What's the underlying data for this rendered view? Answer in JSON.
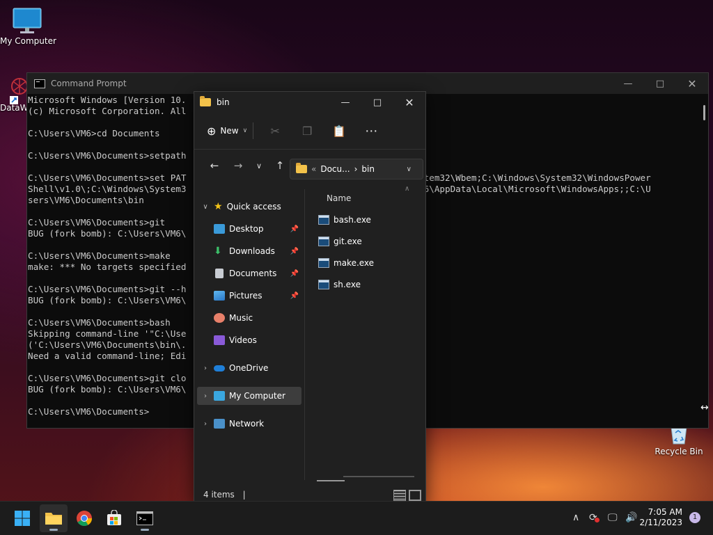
{
  "desktop": {
    "icons": [
      {
        "label": "My Computer"
      },
      {
        "label": "DataW"
      },
      {
        "label": "Recycle Bin"
      }
    ]
  },
  "cmd": {
    "title": "Command Prompt",
    "lines": [
      "Microsoft Windows [Version 10.",
      "(c) Microsoft Corporation. All",
      "",
      "C:\\Users\\VM6>cd Documents",
      "",
      "C:\\Users\\VM6\\Documents>setpath",
      "",
      "C:\\Users\\VM6\\Documents>set PAT                                       ws\\System32\\Wbem;C:\\Windows\\System32\\WindowsPower",
      "Shell\\v1.0\\;C:\\Windows\\System3                                       ers\\VM6\\AppData\\Local\\Microsoft\\WindowsApps;;C:\\U",
      "sers\\VM6\\Documents\\bin",
      "",
      "C:\\Users\\VM6\\Documents>git",
      "BUG (fork bomb): C:\\Users\\VM6\\",
      "",
      "C:\\Users\\VM6\\Documents>make",
      "make: *** No targets specified",
      "",
      "C:\\Users\\VM6\\Documents>git --h",
      "BUG (fork bomb): C:\\Users\\VM6\\",
      "",
      "C:\\Users\\VM6\\Documents>bash",
      "Skipping command-line '\"C:\\Use",
      "('C:\\Users\\VM6\\Documents\\bin\\.",
      "Need a valid command-line; Edi",
      "",
      "C:\\Users\\VM6\\Documents>git clo",
      "BUG (fork bomb): C:\\Users\\VM6\\",
      "",
      "C:\\Users\\VM6\\Documents>"
    ]
  },
  "explorer": {
    "title": "bin",
    "toolbar": {
      "new_label": "New"
    },
    "address": {
      "sep": "«",
      "parent": "Docu...",
      "arrow": "›",
      "current": "bin"
    },
    "nav": {
      "quick_access": "Quick access",
      "items": [
        "Desktop",
        "Downloads",
        "Documents",
        "Pictures",
        "Music",
        "Videos"
      ],
      "onedrive": "OneDrive",
      "my_computer": "My Computer",
      "network": "Network"
    },
    "column_name": "Name",
    "files": [
      "bash.exe",
      "git.exe",
      "make.exe",
      "sh.exe"
    ],
    "status": "4 items"
  },
  "taskbar": {
    "time": "7:05 AM",
    "date": "2/11/2023",
    "notification_count": "1"
  }
}
